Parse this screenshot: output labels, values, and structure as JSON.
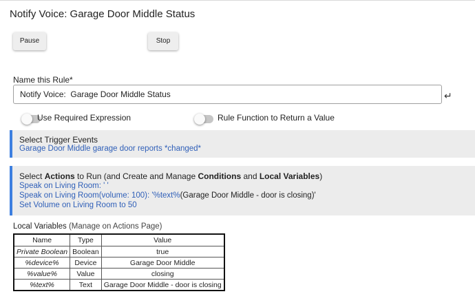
{
  "page": {
    "title": "Notify Voice:  Garage Door Middle Status"
  },
  "controls": {
    "pause_label": "Pause",
    "stop_label": "Stop"
  },
  "name_rule": {
    "label": "Name this Rule*",
    "value": "Notify Voice:  Garage Door Middle Status",
    "enter_icon": "↵"
  },
  "toggles": [
    {
      "label": "Use Required Expression",
      "on": false
    },
    {
      "label": "Rule Function to Return a Value",
      "on": false
    }
  ],
  "triggers": {
    "heading": "Select Trigger Events",
    "items": [
      "Garage Door Middle garage door reports *changed*"
    ]
  },
  "actions": {
    "heading_pre": "Select ",
    "heading_b1": "Actions",
    "heading_mid1": " to Run (and Create and Manage ",
    "heading_b2": "Conditions",
    "heading_mid2": " and ",
    "heading_b3": "Local Variables",
    "heading_post": ")",
    "items": [
      {
        "link": "Speak on Living Room: '  '",
        "plain": ""
      },
      {
        "link": "Speak on Living Room(volume: 100): '%text%",
        "plain": "(Garage Door Middle - door is closing)'"
      },
      {
        "link": "Set Volume on Living Room to 50",
        "plain": ""
      }
    ]
  },
  "local_variables": {
    "caption": "Local Variables",
    "caption_sub": " (Manage on Actions Page)",
    "columns": [
      "Name",
      "Type",
      "Value"
    ],
    "rows": [
      [
        "Private Boolean",
        "Boolean",
        "true"
      ],
      [
        "%device%",
        "Device",
        "Garage Door Middle"
      ],
      [
        "%value%",
        "Value",
        "closing"
      ],
      [
        "%text%",
        "Text",
        "Garage Door Middle - door is closing"
      ]
    ]
  },
  "colors": {
    "accent": "#3d7fe0",
    "link": "#2f5fb8",
    "panel_bg": "#ececec"
  }
}
